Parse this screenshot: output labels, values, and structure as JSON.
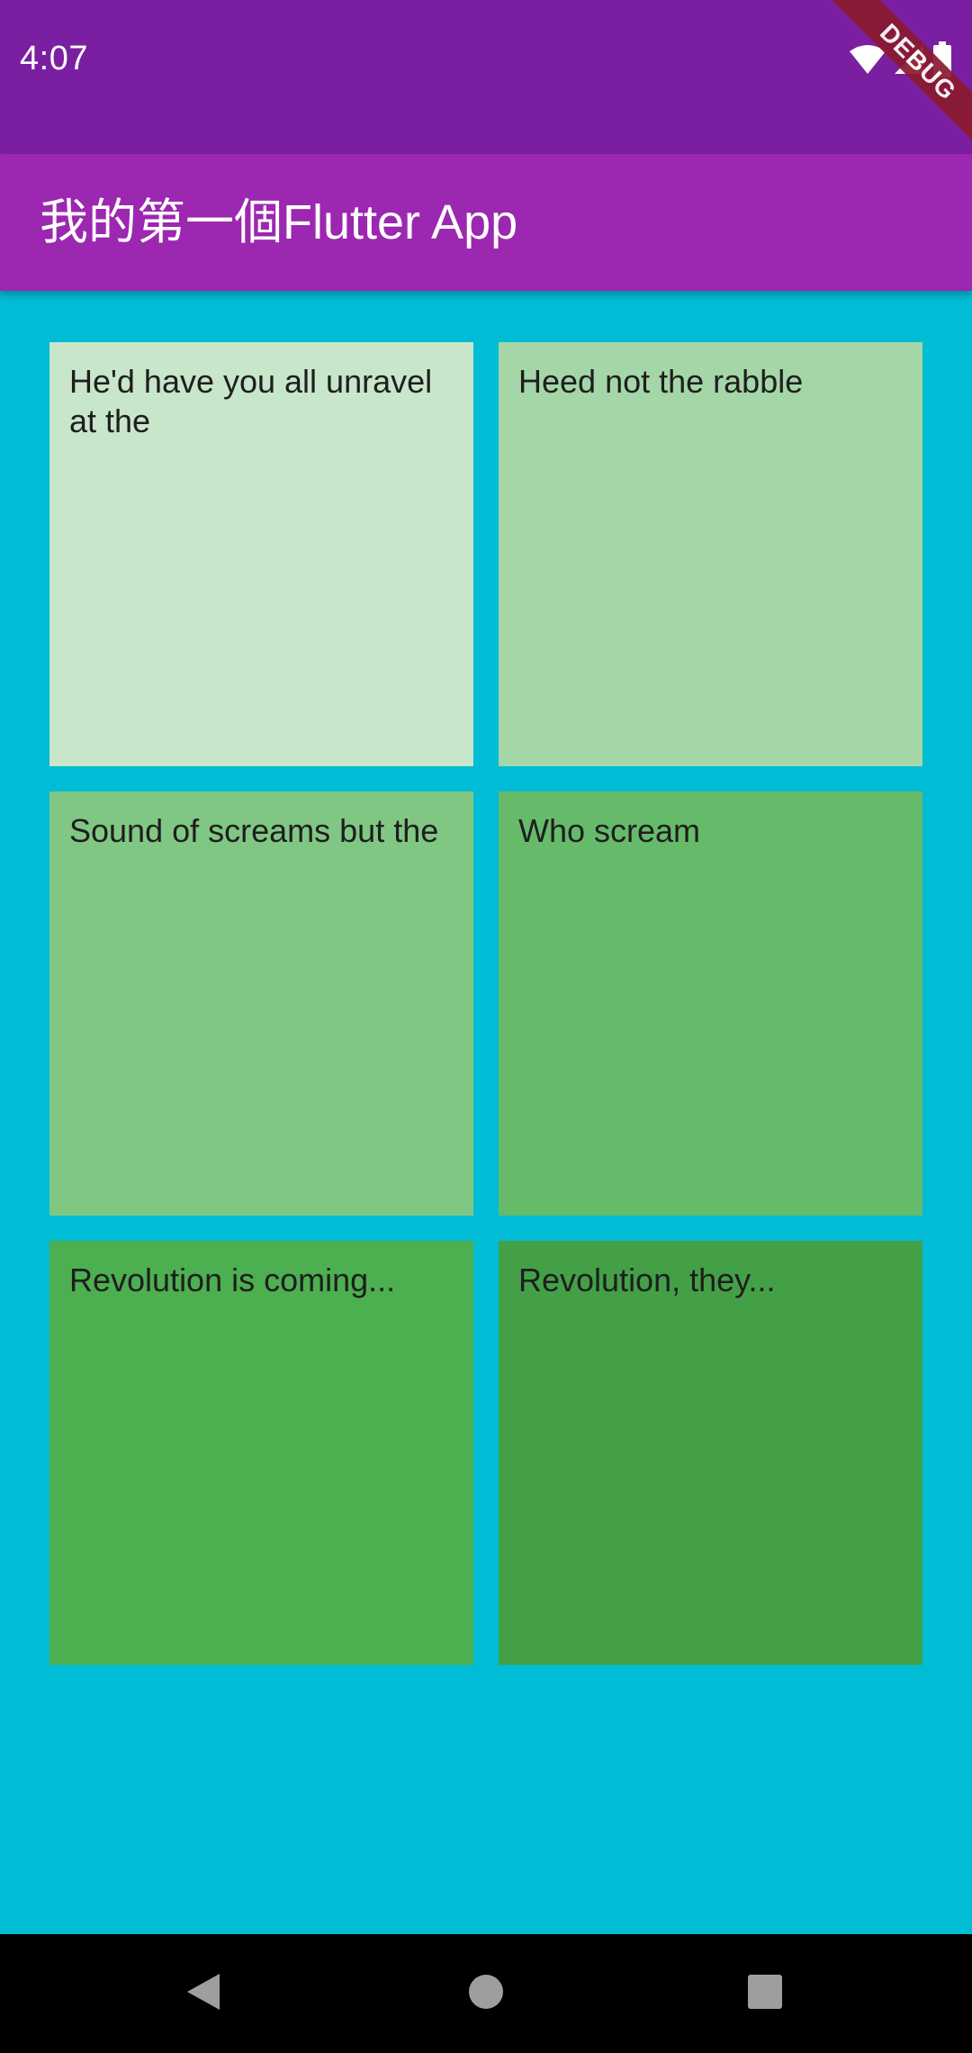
{
  "status_bar": {
    "time": "4:07",
    "icons": [
      "wifi-icon",
      "signal-icon",
      "battery-icon"
    ]
  },
  "debug_banner": {
    "label": "DEBUG"
  },
  "app_bar": {
    "title": "我的第一個Flutter App"
  },
  "grid": {
    "tiles": [
      {
        "text": "He'd have you all unravel at the",
        "color": "#C8E6C9"
      },
      {
        "text": "Heed not the rabble",
        "color": "#A5D6A7"
      },
      {
        "text": "Sound of screams but the",
        "color": "#81C784"
      },
      {
        "text": "Who scream",
        "color": "#66BB6A"
      },
      {
        "text": "Revolution is coming...",
        "color": "#4CAF50"
      },
      {
        "text": "Revolution, they...",
        "color": "#43A047"
      }
    ]
  },
  "nav_bar": {
    "icons": [
      "back-icon",
      "home-icon",
      "recents-icon"
    ]
  },
  "colors": {
    "status_bar": "#7B1FA2",
    "app_bar": "#9C27B0",
    "background": "#00BCD4",
    "nav_bar": "#000000"
  }
}
